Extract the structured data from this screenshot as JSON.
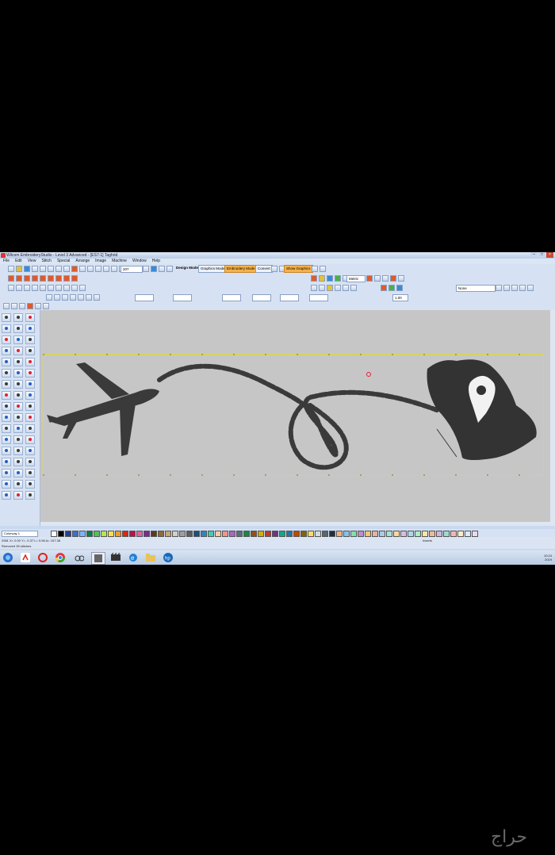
{
  "app": {
    "title": "Wilcom EmbroideryStudio - Level 3 Advanced - [ES7-1]   Taghrid",
    "menu": [
      "File",
      "Edit",
      "View",
      "Stitch",
      "Special",
      "Arrange",
      "Image",
      "Machine",
      "Window",
      "Help"
    ]
  },
  "toolbar": {
    "zoom_value": "207",
    "design_mode_label": "Design Mode:",
    "graphics_mode_label": "Graphics Mode",
    "embroidery_mode_label": "Embroidery Mode",
    "convert_label": "Convert",
    "show_graphics_label": "Show Graphics",
    "metric_value": "Metric",
    "none_value": "None",
    "value_field": "1.00"
  },
  "palette": {
    "colorway_value": "Colorway 1",
    "colors": [
      "#ffffff",
      "#000000",
      "#2a3f8f",
      "#3b6fd0",
      "#7ab6ff",
      "#0d7c4a",
      "#52c25a",
      "#b8e45a",
      "#f4e04c",
      "#f29a2e",
      "#d9261c",
      "#b5154a",
      "#e45fa3",
      "#7b2d8e",
      "#5a3b1f",
      "#8f6a3e",
      "#c7a574",
      "#cfcfcf",
      "#9e9e9e",
      "#5e5e5e",
      "#1f4e79",
      "#2e86c1",
      "#48c9b0",
      "#f5cba7",
      "#f1948a",
      "#a569bd",
      "#5d6d7e",
      "#1e8449",
      "#935116",
      "#d4ac0d",
      "#c0392b",
      "#6c3483",
      "#17a589",
      "#2874a6",
      "#ba4a00",
      "#7d6608",
      "#f7dc6f",
      "#d5dbdb",
      "#566573",
      "#212f3d",
      "#f0b27a",
      "#85c1e9",
      "#82e0aa",
      "#bb8fce",
      "#f8c471",
      "#e6b0aa",
      "#a9cce3",
      "#a3e4d7",
      "#fad7a0",
      "#d7bde2",
      "#aed6f1",
      "#abebc6",
      "#f9e79f",
      "#edbb99",
      "#d2b4de",
      "#a2d9ce",
      "#f5b7b1",
      "#fdebd0",
      "#d6eaf8",
      "#e8daef"
    ]
  },
  "status": {
    "line1": "2981    X= 0.00  Y= -0.37  L= 0.96  A= 157.38",
    "line2": "Removed 35 stitches",
    "center": "Inserts"
  },
  "taskbar": {
    "time": "10:24",
    "date": "2019"
  },
  "watermark": {
    "text": "حراج"
  },
  "colors": {
    "hoop": "#e8e000",
    "canvas": "#c6c6c6",
    "stitch": "#3a3a3a",
    "window_chrome": "#c9d9ef"
  }
}
